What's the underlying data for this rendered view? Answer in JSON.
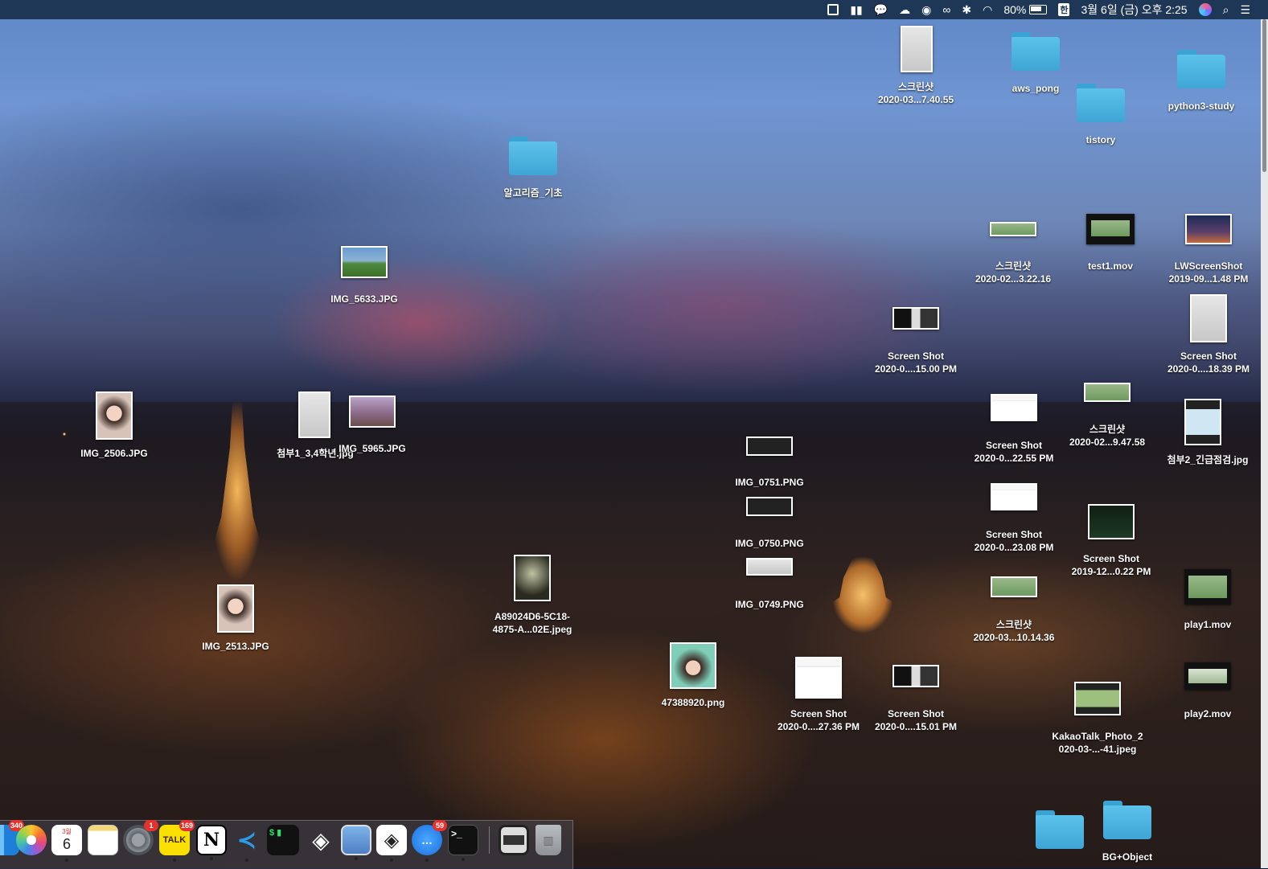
{
  "menubar": {
    "battery": "80%",
    "input_source": "한",
    "datetime": "3월 6일 (금) 오후 2:25"
  },
  "desktop_icons": [
    {
      "label": "스크린샷\n2020-03...7.40.55",
      "line1": "스크린샷",
      "line2": "2020-03...7.40.55"
    },
    {
      "label": "aws_pong"
    },
    {
      "label": "python3-study"
    },
    {
      "label": "tistory"
    },
    {
      "label": "알고리즘_기초"
    },
    {
      "line1": "스크린샷",
      "line2": "2020-02...3.22.16"
    },
    {
      "label": "test1.mov"
    },
    {
      "line1": "LWScreenShot",
      "line2": "2019-09...1.48 PM"
    },
    {
      "label": "IMG_5633.JPG"
    },
    {
      "line1": "Screen Shot",
      "line2": "2020-0....15.00 PM"
    },
    {
      "line1": "Screen Shot",
      "line2": "2020-0....18.39 PM"
    },
    {
      "label": "IMG_2506.JPG"
    },
    {
      "label": "첨부1_3,4학년.jpg"
    },
    {
      "label": "IMG_5965.JPG"
    },
    {
      "line1": "Screen Shot",
      "line2": "2020-0...22.55 PM"
    },
    {
      "line1": "스크린샷",
      "line2": "2020-02...9.47.58"
    },
    {
      "label": "첨부2_긴급점검.jpg"
    },
    {
      "label": "IMG_0751.PNG"
    },
    {
      "label": "IMG_0750.PNG"
    },
    {
      "line1": "Screen Shot",
      "line2": "2020-0...23.08 PM"
    },
    {
      "line1": "Screen Shot",
      "line2": "2019-12...0.22 PM"
    },
    {
      "label": "IMG_0749.PNG"
    },
    {
      "line1": "A89024D6-5C18-",
      "line2": "4875-A...02E.jpeg"
    },
    {
      "label": "IMG_2513.JPG"
    },
    {
      "line1": "스크린샷",
      "line2": "2020-03...10.14.36"
    },
    {
      "label": "play1.mov"
    },
    {
      "label": "47388920.png"
    },
    {
      "line1": "Screen Shot",
      "line2": "2020-0....27.36 PM"
    },
    {
      "line1": "Screen Shot",
      "line2": "2020-0....15.01 PM"
    },
    {
      "label": "play2.mov"
    },
    {
      "line1": "KakaoTalk_Photo_2",
      "line2": "020-03-...-41.jpeg"
    },
    {
      "label": "BG+Object"
    }
  ],
  "dock": {
    "apps": [
      {
        "name": "Finder",
        "badge": "340"
      },
      {
        "name": "Photos",
        "badge": ""
      },
      {
        "name": "Calendar",
        "text": "6",
        "month": "3월"
      },
      {
        "name": "Notes",
        "badge": ""
      },
      {
        "name": "System Preferences",
        "badge": "1"
      },
      {
        "name": "KakaoTalk",
        "text": "TALK",
        "badge": "169"
      },
      {
        "name": "Notion",
        "text": "N"
      },
      {
        "name": "Visual Studio Code"
      },
      {
        "name": "iTerm",
        "text": "$ ▮"
      },
      {
        "name": "Unity"
      },
      {
        "name": "Preview"
      },
      {
        "name": "Unity Hub"
      },
      {
        "name": "Messenger",
        "badge": "59"
      },
      {
        "name": "Terminal",
        "text": ">_"
      },
      {
        "name": "Screenshot"
      },
      {
        "name": "Trash"
      }
    ]
  }
}
